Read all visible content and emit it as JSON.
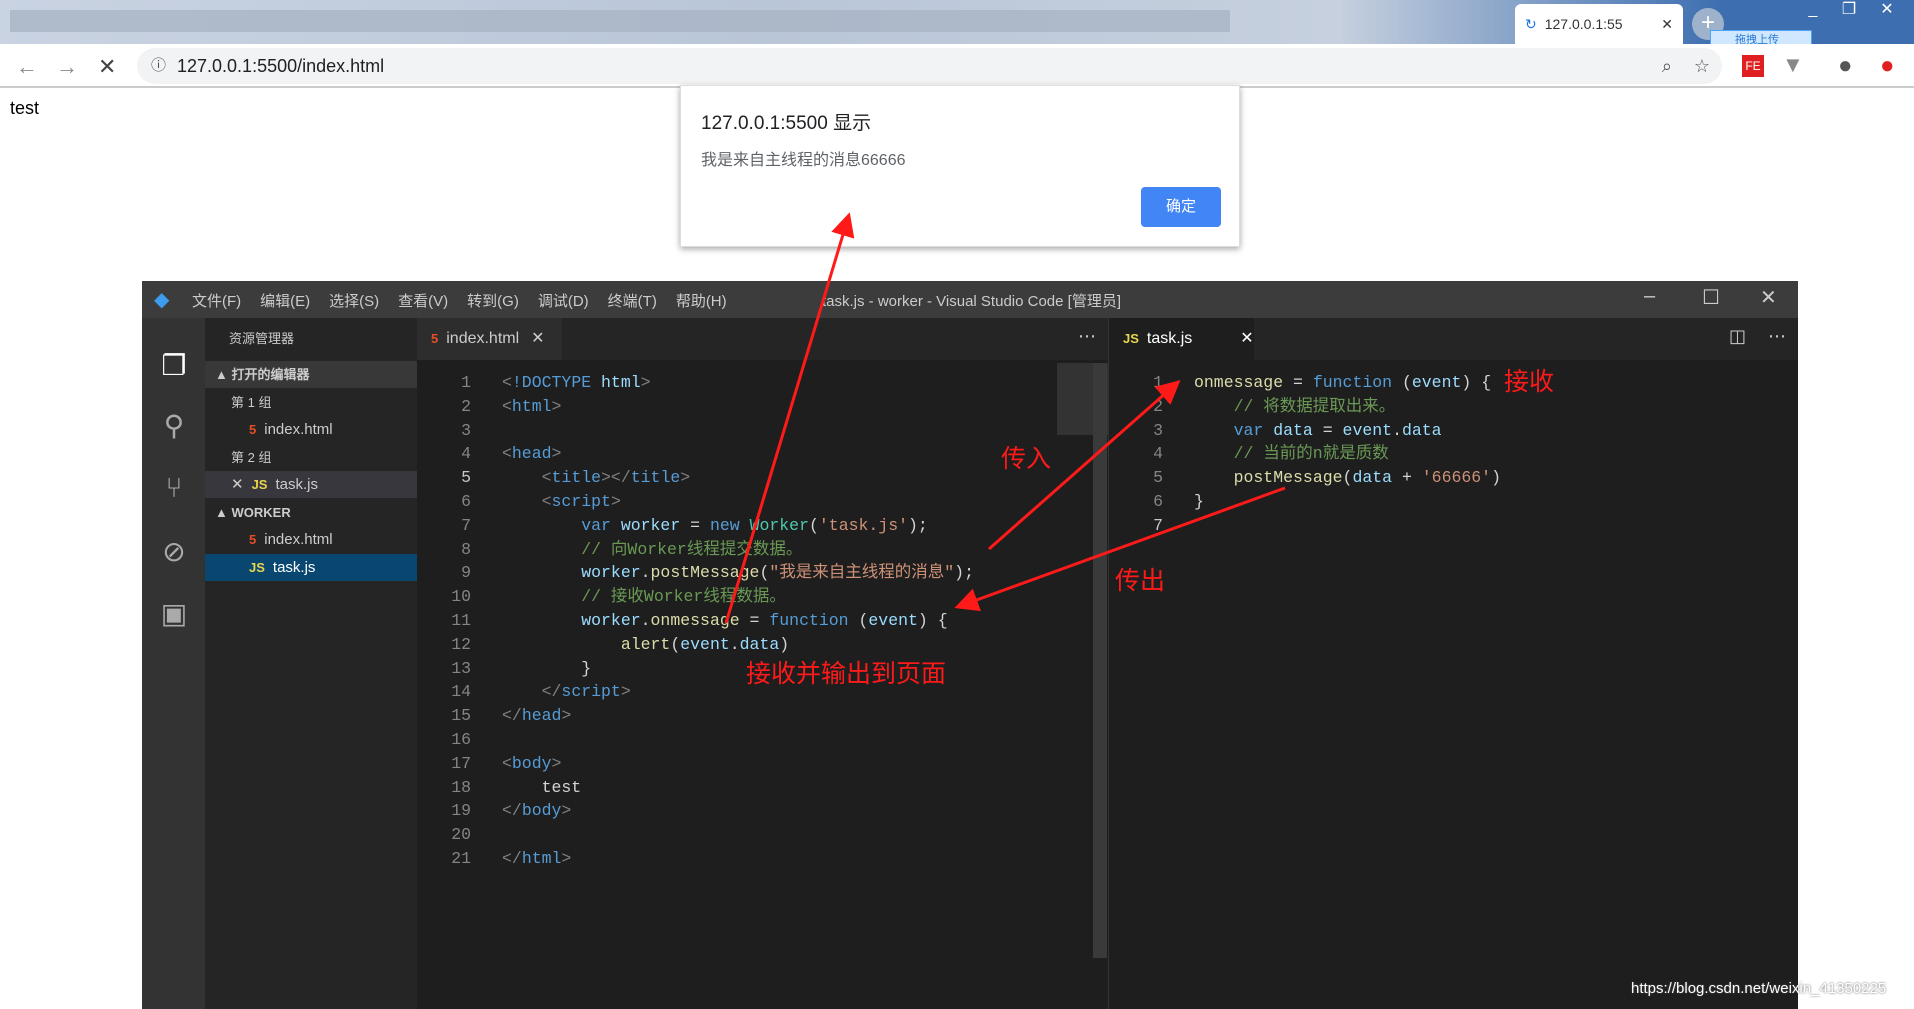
{
  "browser": {
    "tab_title": "127.0.0.1:55",
    "upload_badge": "拖拽上传",
    "url": "127.0.0.1:5500/index.html",
    "page_text": "test"
  },
  "dialog": {
    "title": "127.0.0.1:5500 显示",
    "message": "我是来自主线程的消息66666",
    "ok": "确定"
  },
  "vscode": {
    "menu": [
      "文件(F)",
      "编辑(E)",
      "选择(S)",
      "查看(V)",
      "转到(G)",
      "调试(D)",
      "终端(T)",
      "帮助(H)"
    ],
    "window_title": "task.js - worker - Visual Studio Code [管理员]",
    "sidebar": {
      "title": "资源管理器",
      "open_editors": "打开的编辑器",
      "group1": "第 1 组",
      "g1_file": "index.html",
      "group2": "第 2 组",
      "g2_file": "task.js",
      "folder": "WORKER",
      "f1": "index.html",
      "f2": "task.js"
    },
    "left_tab": "index.html",
    "right_tab": "task.js",
    "left_code": [
      [
        [
          "<",
          "p"
        ],
        [
          "!DOCTYPE",
          "t"
        ],
        [
          " html",
          "a"
        ],
        [
          ">",
          "p"
        ]
      ],
      [
        [
          "<",
          "p"
        ],
        [
          "html",
          "t"
        ],
        [
          ">",
          "p"
        ]
      ],
      [],
      [
        [
          "<",
          "p"
        ],
        [
          "head",
          "t"
        ],
        [
          ">",
          "p"
        ]
      ],
      [
        [
          "    <",
          "p"
        ],
        [
          "title",
          "t"
        ],
        [
          "></",
          "p"
        ],
        [
          "title",
          "t"
        ],
        [
          ">",
          "p"
        ]
      ],
      [
        [
          "    <",
          "p"
        ],
        [
          "script",
          "t"
        ],
        [
          ">",
          "p"
        ]
      ],
      [
        [
          "        var",
          "k"
        ],
        [
          " worker",
          "v"
        ],
        [
          " = ",
          "n"
        ],
        [
          "new",
          "k"
        ],
        [
          " Worker",
          "cls"
        ],
        [
          "(",
          "n"
        ],
        [
          "'task.js'",
          "s"
        ],
        [
          ");",
          "n"
        ]
      ],
      [
        [
          "        // 向Worker线程提交数据。",
          "c"
        ]
      ],
      [
        [
          "        worker",
          "v"
        ],
        [
          ".",
          "n"
        ],
        [
          "postMessage",
          "f"
        ],
        [
          "(",
          "n"
        ],
        [
          "\"我是来自主线程的消息\"",
          "s"
        ],
        [
          ");",
          "n"
        ]
      ],
      [
        [
          "        // 接收Worker线程数据。",
          "c"
        ]
      ],
      [
        [
          "        worker",
          "v"
        ],
        [
          ".",
          "n"
        ],
        [
          "onmessage",
          "f"
        ],
        [
          " = ",
          "n"
        ],
        [
          "function",
          "k"
        ],
        [
          " (",
          "n"
        ],
        [
          "event",
          "v"
        ],
        [
          ") {",
          "n"
        ]
      ],
      [
        [
          "            alert",
          "f"
        ],
        [
          "(",
          "n"
        ],
        [
          "event",
          "v"
        ],
        [
          ".",
          "n"
        ],
        [
          "data",
          "v"
        ],
        [
          ")",
          "n"
        ]
      ],
      [
        [
          "        }",
          "n"
        ]
      ],
      [
        [
          "    </",
          "p"
        ],
        [
          "script",
          "t"
        ],
        [
          ">",
          "p"
        ]
      ],
      [
        [
          "</",
          "p"
        ],
        [
          "head",
          "t"
        ],
        [
          ">",
          "p"
        ]
      ],
      [],
      [
        [
          "<",
          "p"
        ],
        [
          "body",
          "t"
        ],
        [
          ">",
          "p"
        ]
      ],
      [
        [
          "    test",
          "n"
        ]
      ],
      [
        [
          "</",
          "p"
        ],
        [
          "body",
          "t"
        ],
        [
          ">",
          "p"
        ]
      ],
      [],
      [
        [
          "</",
          "p"
        ],
        [
          "html",
          "t"
        ],
        [
          ">",
          "p"
        ]
      ]
    ],
    "right_code": [
      [
        [
          "onmessage",
          "f"
        ],
        [
          " = ",
          "n"
        ],
        [
          "function",
          "k"
        ],
        [
          " (",
          "n"
        ],
        [
          "event",
          "v"
        ],
        [
          ") {",
          "n"
        ]
      ],
      [
        [
          "    // 将数据提取出来。",
          "c"
        ]
      ],
      [
        [
          "    var",
          "k"
        ],
        [
          " data",
          "v"
        ],
        [
          " = ",
          "n"
        ],
        [
          "event",
          "v"
        ],
        [
          ".",
          "n"
        ],
        [
          "data",
          "v"
        ]
      ],
      [
        [
          "    // 当前的n就是质数",
          "c"
        ]
      ],
      [
        [
          "    postMessage",
          "f"
        ],
        [
          "(",
          "n"
        ],
        [
          "data",
          "v"
        ],
        [
          " + ",
          "n"
        ],
        [
          "'66666'",
          "s"
        ],
        [
          ")",
          "n"
        ]
      ],
      [
        [
          "}",
          "n"
        ]
      ],
      []
    ]
  },
  "annotations": {
    "receive": "接收",
    "pass_in": "传入",
    "pass_out": "传出",
    "receive_output": "接收并输出到页面",
    "color": "#ff1a1a"
  },
  "watermark": "https://blog.csdn.net/weixin_41350225"
}
